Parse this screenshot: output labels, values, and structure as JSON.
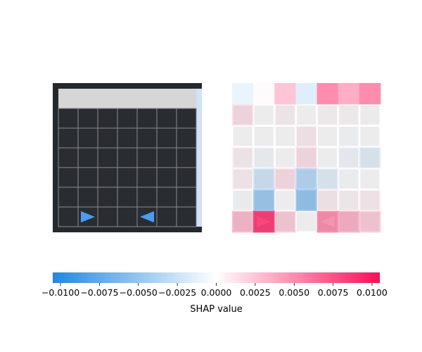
{
  "chart_data": [
    {
      "type": "heatmap",
      "panel": "input-observation",
      "grid_rows": 7,
      "grid_cols": 7,
      "cells": [
        [
          "bar",
          "bar",
          "bar",
          "bar",
          "bar",
          "bar",
          "bar"
        ],
        [
          "empty",
          "empty",
          "empty",
          "empty",
          "empty",
          "empty",
          "empty"
        ],
        [
          "empty",
          "empty",
          "empty",
          "empty",
          "empty",
          "empty",
          "empty"
        ],
        [
          "empty",
          "empty",
          "empty",
          "empty",
          "empty",
          "empty",
          "empty"
        ],
        [
          "empty",
          "empty",
          "empty",
          "empty",
          "empty",
          "empty",
          "empty"
        ],
        [
          "empty",
          "empty",
          "empty",
          "empty",
          "empty",
          "empty",
          "empty"
        ],
        [
          "empty",
          "arrow-right",
          "empty",
          "empty",
          "arrow-left",
          "empty",
          "empty"
        ]
      ],
      "colors": {
        "frame": "#24292d",
        "cell": "#292d31",
        "grid_line": "#8a8a8a",
        "bar": "#d6d6d6",
        "arrow": "#4a9bf2",
        "side_strip": "#cfe2f8"
      }
    },
    {
      "type": "heatmap",
      "panel": "shap-attribution",
      "grid_rows": 7,
      "grid_cols": 7,
      "values": [
        [
          -0.001,
          0.0002,
          0.0025,
          -0.0015,
          0.005,
          0.0035,
          0.005
        ],
        [
          0.0015,
          0.0,
          0.0005,
          0.0,
          0.0003,
          0.0002,
          0.0001
        ],
        [
          0.0,
          0.0,
          0.0,
          0.0008,
          0.0,
          -0.0002,
          0.0
        ],
        [
          0.0006,
          -0.0004,
          0.0,
          0.0015,
          0.0,
          -0.0006,
          -0.0015
        ],
        [
          0.0006,
          -0.0025,
          0.0015,
          -0.004,
          -0.0015,
          -0.0002,
          0.0
        ],
        [
          -0.0003,
          -0.0055,
          0.0,
          -0.006,
          0.0008,
          0.0004,
          0.0006
        ],
        [
          0.0035,
          0.0105,
          0.0025,
          0.0,
          0.006,
          0.004,
          0.0025
        ]
      ],
      "overlay_rows": [
        [
          "bar",
          "bar",
          "bar",
          "bar",
          "bar",
          "bar",
          "bar"
        ],
        [
          "empty",
          "empty",
          "empty",
          "empty",
          "empty",
          "empty",
          "empty"
        ],
        [
          "empty",
          "empty",
          "empty",
          "empty",
          "empty",
          "empty",
          "empty"
        ],
        [
          "empty",
          "empty",
          "empty",
          "empty",
          "empty",
          "empty",
          "empty"
        ],
        [
          "empty",
          "empty",
          "empty",
          "empty",
          "empty",
          "empty",
          "empty"
        ],
        [
          "empty",
          "empty",
          "empty",
          "empty",
          "empty",
          "empty",
          "empty"
        ],
        [
          "empty",
          "arrow-right",
          "empty",
          "empty",
          "arrow-left",
          "empty",
          "empty"
        ]
      ],
      "vmin": -0.0105,
      "vmax": 0.0105
    },
    {
      "type": "colorbar",
      "xlabel": "SHAP value",
      "range": [
        -0.0105,
        0.0105
      ],
      "tick_values": [
        -0.01,
        -0.0075,
        -0.005,
        -0.0025,
        0.0,
        0.0025,
        0.005,
        0.0075,
        0.01
      ],
      "tick_labels": [
        "−0.0100",
        "−0.0075",
        "−0.0050",
        "−0.0025",
        "0.0000",
        "0.0025",
        "0.0050",
        "0.0075",
        "0.0100"
      ],
      "colors": {
        "negative": "#1e88e5",
        "zero": "#ffffff",
        "positive": "#ff0d57"
      }
    }
  ]
}
